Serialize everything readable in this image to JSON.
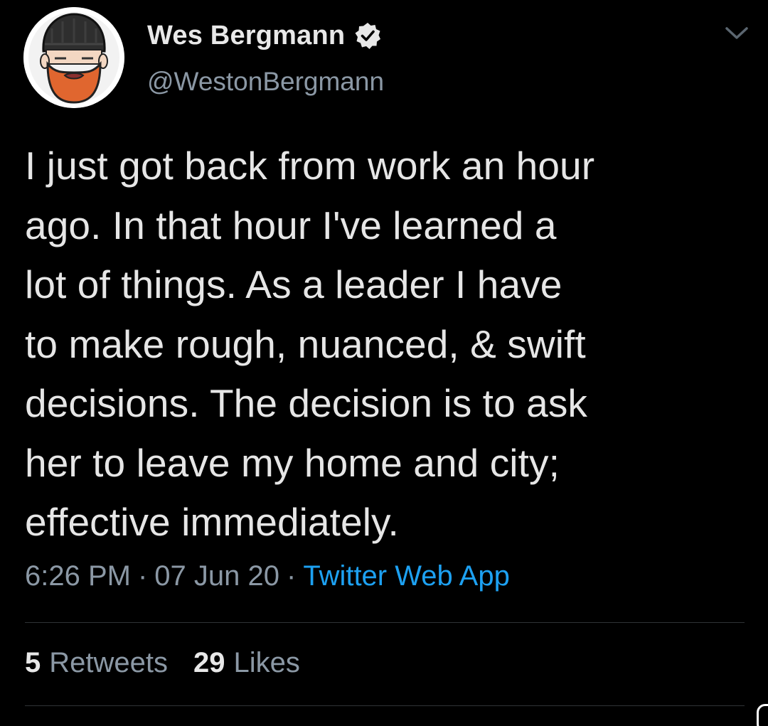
{
  "author": {
    "display_name": "Wes Bergmann",
    "handle": "@WestonBergmann",
    "verified": true,
    "avatar_icon": "bearded-man-avatar-icon"
  },
  "tweet": {
    "text_lines": [
      "I just got back from work an hour",
      "ago. In that hour I've learned a",
      "lot of things. As a leader I have",
      "to make rough, nuanced, & swift",
      "decisions. The decision is to ask",
      "her to leave my home and city;",
      "effective immediately."
    ],
    "time": "6:26 PM",
    "separator": "·",
    "date": "07 Jun 20",
    "source": "Twitter Web App"
  },
  "stats": {
    "retweets_count": "5",
    "retweets_label": "Retweets",
    "likes_count": "29",
    "likes_label": "Likes"
  },
  "colors": {
    "background": "#000000",
    "text": "#e6e6e6",
    "secondary": "#8b98a5",
    "accent": "#1da1f2",
    "beard": "#e0662f",
    "beanie": "#2e2e2e"
  }
}
